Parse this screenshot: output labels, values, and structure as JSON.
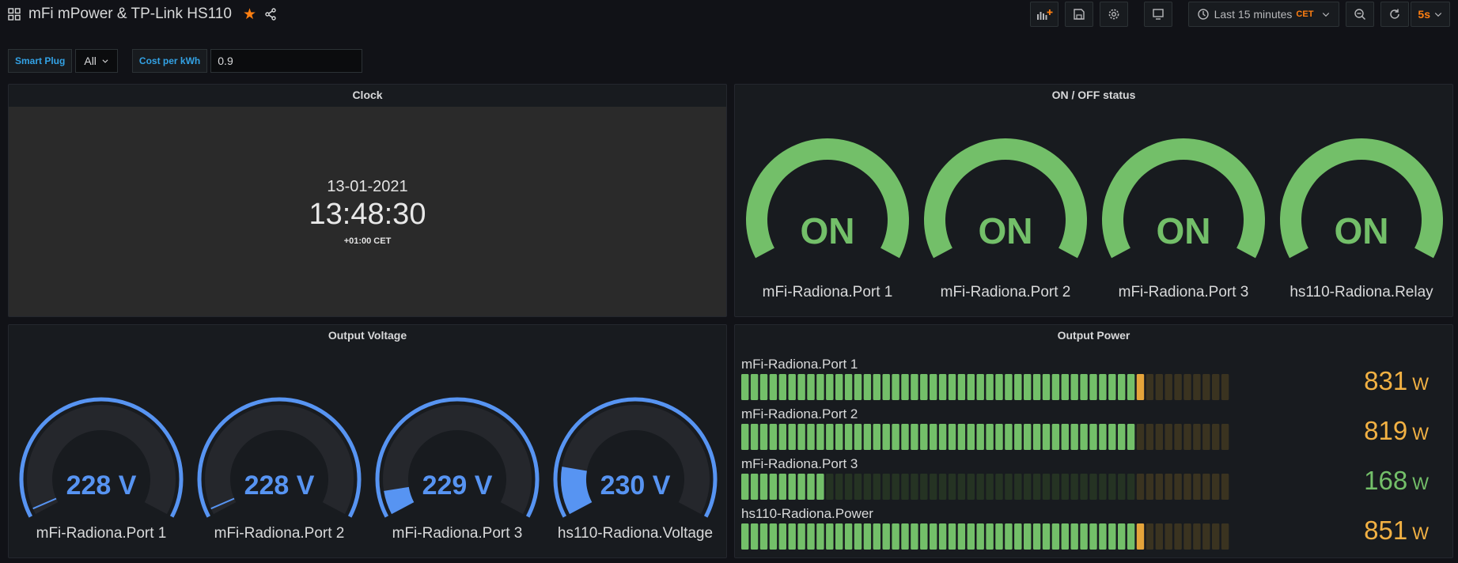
{
  "header": {
    "title": "mFi mPower & TP-Link HS110",
    "time_range": "Last 15 minutes",
    "timezone": "CET",
    "refresh": "5s"
  },
  "variables": {
    "smart_plug_label": "Smart Plug",
    "smart_plug_value": "All",
    "cost_label": "Cost per kWh",
    "cost_value": "0.9"
  },
  "clock": {
    "title": "Clock",
    "date": "13-01-2021",
    "time": "13:48:30",
    "zone": "+01:00 CET"
  },
  "status": {
    "title": "ON / OFF status",
    "color": "#73bf69",
    "items": [
      {
        "name": "mFi-Radiona.Port 1",
        "value": "ON"
      },
      {
        "name": "mFi-Radiona.Port 2",
        "value": "ON"
      },
      {
        "name": "mFi-Radiona.Port 3",
        "value": "ON"
      },
      {
        "name": "hs110-Radiona.Relay",
        "value": "ON"
      }
    ]
  },
  "voltage": {
    "title": "Output Voltage",
    "color": "#5794f2",
    "items": [
      {
        "name": "mFi-Radiona.Port 1",
        "value": "228 V",
        "fill": 0.02
      },
      {
        "name": "mFi-Radiona.Port 2",
        "value": "228 V",
        "fill": 0.02
      },
      {
        "name": "mFi-Radiona.Port 3",
        "value": "229 V",
        "fill": 0.08
      },
      {
        "name": "hs110-Radiona.Voltage",
        "value": "230 V",
        "fill": 0.16
      }
    ]
  },
  "power": {
    "title": "Output Power",
    "unit": "W",
    "items": [
      {
        "name": "mFi-Radiona.Port 1",
        "value": "831",
        "level": 0.82,
        "color": "#f2b143"
      },
      {
        "name": "mFi-Radiona.Port 2",
        "value": "819",
        "level": 0.81,
        "color": "#f2b143"
      },
      {
        "name": "mFi-Radiona.Port 3",
        "value": "168",
        "level": 0.18,
        "color": "#73bf69"
      },
      {
        "name": "hs110-Radiona.Power",
        "value": "851",
        "level": 0.835,
        "color": "#f2b143"
      }
    ]
  }
}
